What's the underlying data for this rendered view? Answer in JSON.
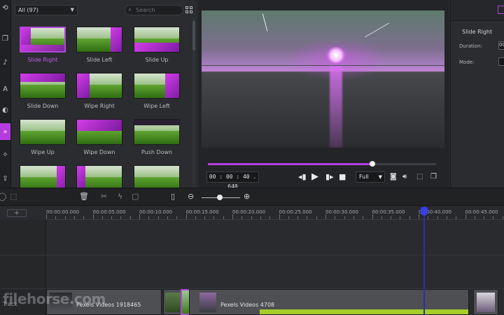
{
  "library": {
    "filter_label": "All (97)",
    "search_placeholder": "Search",
    "transitions": [
      {
        "label": "Slide Right",
        "selected": true
      },
      {
        "label": "Slide Left",
        "selected": false
      },
      {
        "label": "Slide Up",
        "selected": false
      },
      {
        "label": "Slide Down",
        "selected": false
      },
      {
        "label": "Wipe Right",
        "selected": false
      },
      {
        "label": "Wipe Left",
        "selected": false
      },
      {
        "label": "Wipe Up",
        "selected": false
      },
      {
        "label": "Wipe Down",
        "selected": false
      },
      {
        "label": "Push Down",
        "selected": false
      },
      {
        "label": "",
        "selected": false
      },
      {
        "label": "",
        "selected": false
      },
      {
        "label": "",
        "selected": false
      }
    ]
  },
  "rail": {
    "icons": [
      "sync-icon",
      "layers-icon",
      "audio-icon",
      "text-icon",
      "filters-icon",
      "transitions-icon",
      "effects-icon",
      "export-icon"
    ],
    "active": "transitions-icon"
  },
  "player": {
    "timecode": "00 : 00 : 40 . 640",
    "progress_fraction": 0.72,
    "quality": "Full",
    "icons": [
      "prev-frame-icon",
      "play-icon",
      "next-frame-icon",
      "stop-icon",
      "snapshot-icon",
      "volume-icon",
      "fit-icon",
      "fullscreen-icon"
    ]
  },
  "properties": {
    "title": "Slide Right",
    "duration_label": "Duration:",
    "mode_label": "Mode:",
    "duration_value": "00",
    "mode_value": ""
  },
  "toolbar": {
    "icons": [
      "undo-icon",
      "crop-icon",
      "delete-icon",
      "split-icon",
      "speed-icon",
      "rotate-icon",
      "marker-icon",
      "zoom-out-icon",
      "zoom-in-icon"
    ],
    "zoom_fraction": 0.45
  },
  "timeline": {
    "ticks": [
      "00:00:00.000",
      "00:00:05.000",
      "00:00:10.000",
      "00:00:15.000",
      "00:00:20.000",
      "00:00:25.000",
      "00:00:30.000",
      "00:00:35.000",
      "00:00:40.000",
      "00:00:45.000"
    ],
    "add_track": "+",
    "track_label": "Track",
    "clips": [
      {
        "label": "Pexels Videos 1918465"
      },
      {
        "label": "Pexels Videos 4708"
      }
    ],
    "watermark": "filehorse.com"
  },
  "colors": {
    "accent": "#b23fe0",
    "playhead": "#3a3cf0",
    "clip_audio": "#a6cc2a",
    "background": "#26282b"
  }
}
